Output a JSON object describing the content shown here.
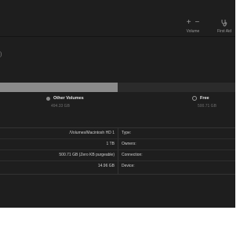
{
  "toolbar": {
    "volume": {
      "label": "Volume",
      "add_glyph": "+",
      "remove_glyph": "−"
    },
    "first_aid": {
      "label": "First Aid",
      "icon": "stethoscope-icon"
    }
  },
  "header_stub": ")",
  "usage_bar": {
    "used_fraction": 0.5,
    "used_color": "#8a8a8a",
    "free_color": "#2b2b2b"
  },
  "legend": {
    "other_volumes": {
      "name": "Other Volumes",
      "size": "494.33 GB"
    },
    "free": {
      "name": "Free",
      "size": "500.71 GB"
    }
  },
  "info": {
    "rows": [
      {
        "value": "/Volumes/Macintosh HD 1",
        "label": "Type:"
      },
      {
        "value": "1 TB",
        "label": "Owners:"
      },
      {
        "value": "500.71 GB (Zero KB purgeable)",
        "label": "Connection:"
      },
      {
        "value": "14.96 GB",
        "label": "Device:"
      }
    ]
  }
}
